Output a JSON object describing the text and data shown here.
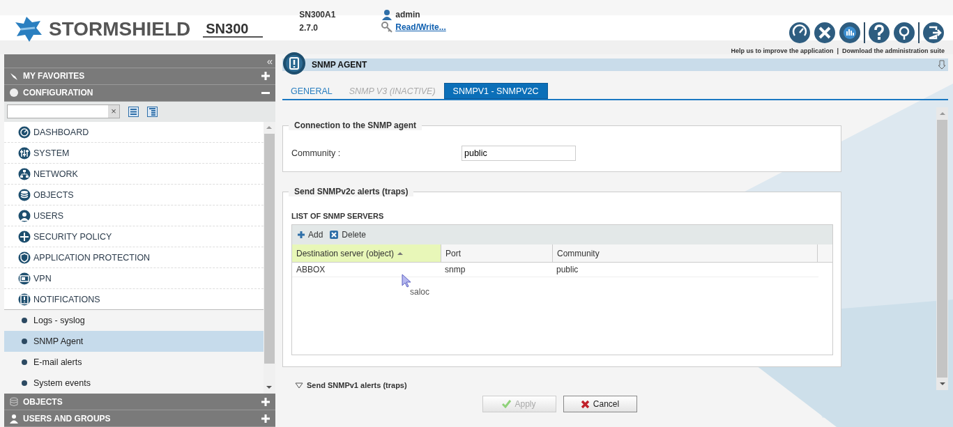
{
  "header": {
    "brand": "STORMSHIELD",
    "model": "SN300",
    "serial": "SN300A1",
    "version": "2.7.0",
    "user": "admin",
    "access_link": "Read/Write...",
    "help_link": "Help us to improve the application",
    "separator": "|",
    "download_link": "Download the administration suite"
  },
  "sidebar": {
    "collapse": "«",
    "top_sections": [
      {
        "label": "MY FAVORITES",
        "expanded": false
      },
      {
        "label": "CONFIGURATION",
        "expanded": true
      }
    ],
    "filter": {
      "clear": "×"
    },
    "items": [
      {
        "kind": "module",
        "label": "DASHBOARD",
        "selected": false
      },
      {
        "kind": "module",
        "label": "SYSTEM",
        "selected": false
      },
      {
        "kind": "module",
        "label": "NETWORK",
        "selected": false
      },
      {
        "kind": "module",
        "label": "OBJECTS",
        "selected": false
      },
      {
        "kind": "module",
        "label": "USERS",
        "selected": false
      },
      {
        "kind": "module",
        "label": "SECURITY POLICY",
        "selected": false
      },
      {
        "kind": "module",
        "label": "APPLICATION PROTECTION",
        "selected": false
      },
      {
        "kind": "module",
        "label": "VPN",
        "selected": false
      },
      {
        "kind": "module",
        "label": "NOTIFICATIONS",
        "selected": false
      },
      {
        "kind": "sub",
        "label": "Logs - syslog",
        "selected": false
      },
      {
        "kind": "sub",
        "label": "SNMP Agent",
        "selected": true
      },
      {
        "kind": "sub",
        "label": "E-mail alerts",
        "selected": false
      },
      {
        "kind": "sub",
        "label": "System events",
        "selected": false
      }
    ],
    "bottom_sections": [
      {
        "label": "OBJECTS",
        "expanded": false
      },
      {
        "label": "USERS AND GROUPS",
        "expanded": false
      }
    ]
  },
  "page": {
    "title": "SNMP AGENT",
    "tabs": [
      {
        "label": "GENERAL",
        "selected": false,
        "disabled": false
      },
      {
        "label": "SNMP V3 (INACTIVE)",
        "selected": false,
        "disabled": true
      },
      {
        "label": "SNMPV1 - SNMPV2C",
        "selected": true,
        "disabled": false
      }
    ],
    "connection": {
      "legend": "Connection to the SNMP agent",
      "label": "Community :",
      "value": "public"
    },
    "traps": {
      "legend": "Send SNMPv2c alerts (traps)",
      "list_title": "LIST OF SNMP SERVERS",
      "actions": [
        "Add",
        "Delete"
      ],
      "columns": [
        {
          "label": "Destination server (object)",
          "sorted": true
        },
        {
          "label": "Port",
          "sorted": false
        },
        {
          "label": "Community",
          "sorted": false
        }
      ],
      "rows": [
        [
          "ABBOX",
          "snmp",
          "public"
        ]
      ],
      "hover_text": "saloc"
    },
    "collapsed_section": {
      "label": "Send SNMPv1 alerts (traps)",
      "expanded": false
    },
    "buttons": [
      {
        "label": "Apply",
        "disabled": true,
        "kind": "apply"
      },
      {
        "label": "Cancel",
        "disabled": false,
        "kind": "cancel"
      }
    ]
  }
}
